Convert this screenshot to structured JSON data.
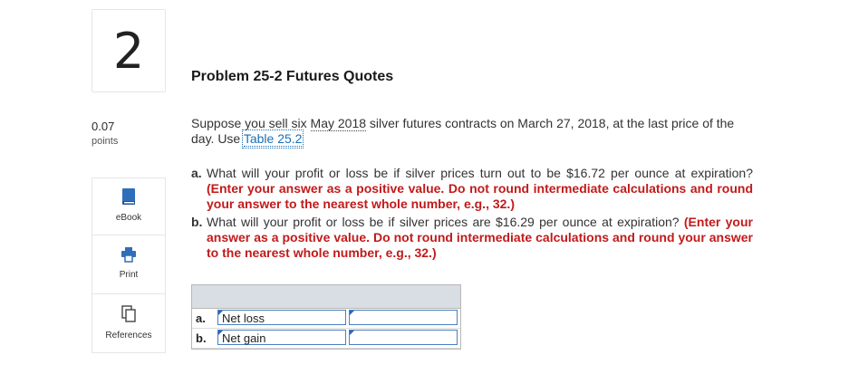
{
  "question": {
    "number": "2",
    "points_value": "0.07",
    "points_label": "points"
  },
  "tools": [
    {
      "label": "eBook",
      "icon": "book-icon"
    },
    {
      "label": "Print",
      "icon": "printer-icon"
    },
    {
      "label": "References",
      "icon": "references-icon"
    }
  ],
  "problem": {
    "title": "Problem 25-2 Futures Quotes",
    "intro_pre": "Suppose you sell six ",
    "intro_dotted": "May 2018",
    "intro_mid": " silver futures contracts on March 27, 2018, at the last price of the day. Use ",
    "table_link": "Table 25.2",
    "parts": [
      {
        "letter": "a.",
        "text": "What will your profit or loss be if silver prices turn out to be $16.72 per ounce at expiration? ",
        "instruction": "(Enter your answer as a positive value. Do not round intermediate calculations and round your answer to the nearest whole number, e.g., 32.)"
      },
      {
        "letter": "b.",
        "text": "What will your profit or loss be if silver prices are $16.29 per ounce at expiration? ",
        "instruction": "(Enter your answer as a positive value. Do not round intermediate calculations and round your answer to the nearest whole number, e.g., 32.)"
      }
    ]
  },
  "answers": [
    {
      "letter": "a.",
      "selected": "Net loss",
      "value": ""
    },
    {
      "letter": "b.",
      "selected": "Net gain",
      "value": ""
    }
  ]
}
